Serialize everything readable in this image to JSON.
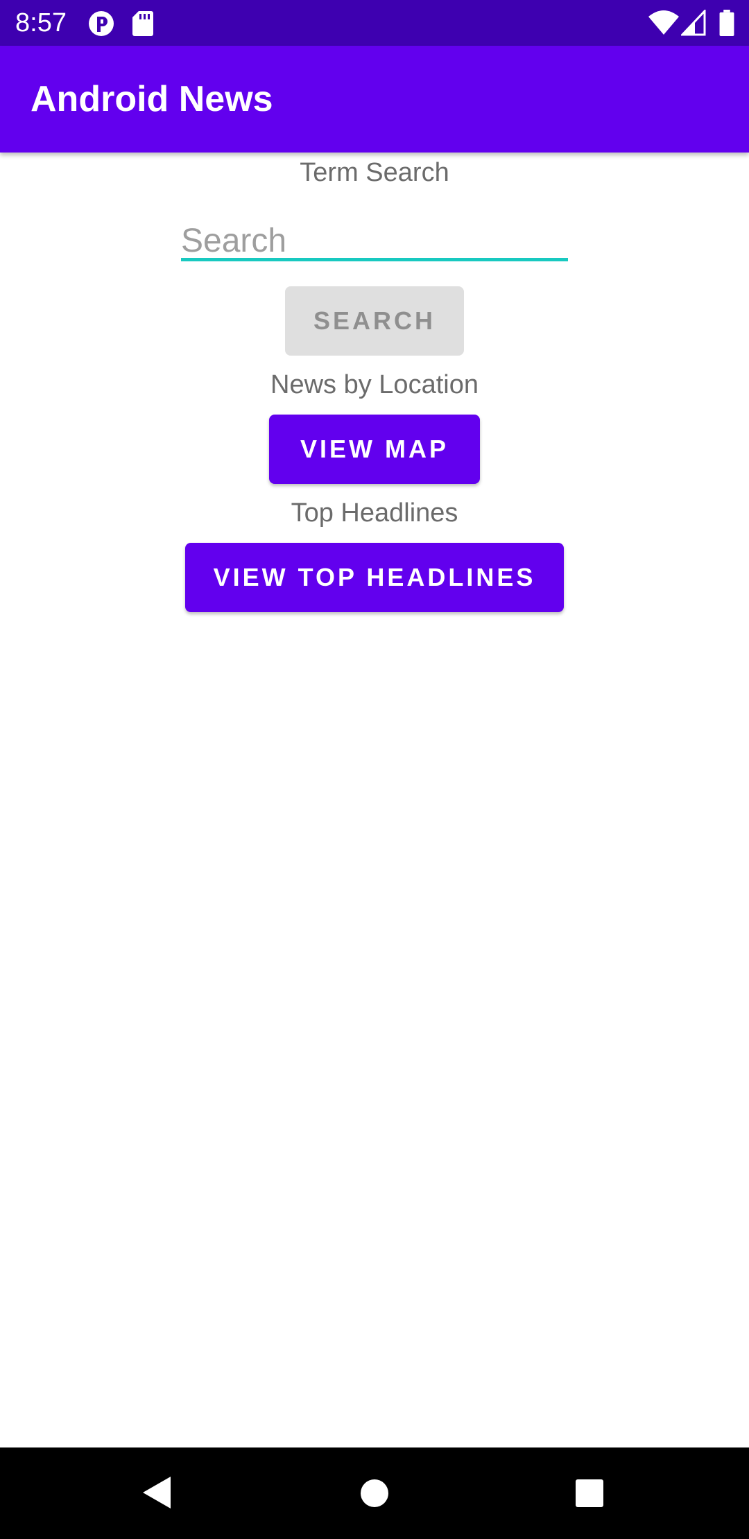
{
  "status_bar": {
    "time": "8:57",
    "left_icons": [
      "data-saver-icon",
      "sd-card-icon"
    ],
    "right_icons": [
      "wifi-icon",
      "cell-signal-icon",
      "battery-icon"
    ],
    "background_color": "#3E00B0"
  },
  "app_bar": {
    "title": "Android News",
    "background_color": "#6200EE"
  },
  "term_search": {
    "label": "Term Search",
    "placeholder": "Search",
    "value": "",
    "underline_color": "#18C9C0",
    "button_label": "SEARCH",
    "button_enabled": false
  },
  "location": {
    "label": "News by Location",
    "button_label": "VIEW MAP"
  },
  "headlines": {
    "label": "Top Headlines",
    "button_label": "VIEW TOP HEADLINES"
  },
  "nav_bar": {
    "buttons": [
      "back-icon",
      "home-icon",
      "recents-icon"
    ]
  },
  "colors": {
    "accent": "#6200EE",
    "disabled_button": "#DFDFDF",
    "label_text": "#6b6b6b"
  }
}
